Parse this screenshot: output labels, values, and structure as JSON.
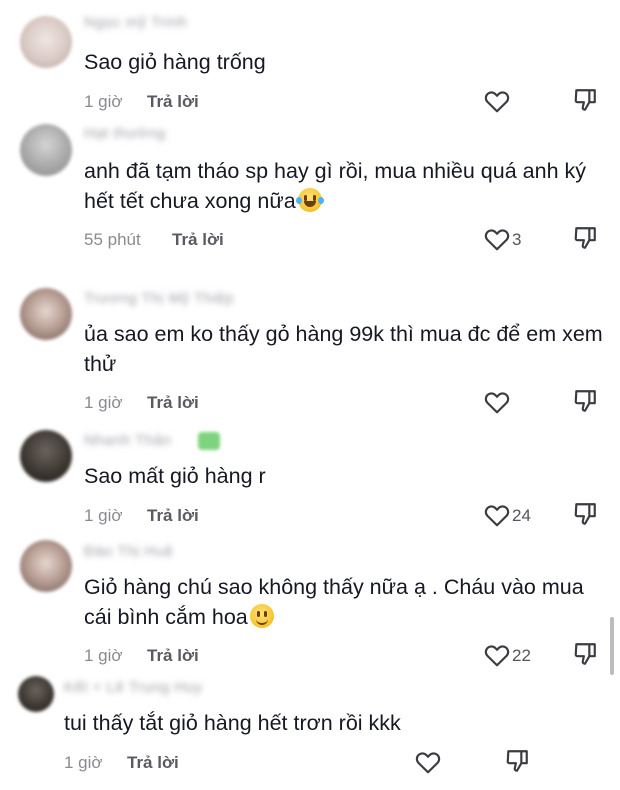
{
  "ui": {
    "reply_label": "Trả lời"
  },
  "comments": [
    {
      "username": "Ngọc mỹ Trinh",
      "text": "Sao giỏ hàng trống",
      "time": "1 giờ",
      "likes": ""
    },
    {
      "username": "Hạt thường",
      "text": "anh đã tạm tháo sp hay gì rồi, mua nhiều quá anh ký hết tết chưa xong nữa",
      "time": "55 phút",
      "likes": "3",
      "emoji": "face-with-tears-of-joy"
    },
    {
      "username": "Trương Thị Mỹ Thiệp",
      "text": "ủa sao em ko thấy gỏ hàng 99k thì mua đc để em xem thử",
      "time": "1 giờ",
      "likes": ""
    },
    {
      "username": "Nhanh Thân",
      "text": "Sao mất giỏ hàng r",
      "time": "1 giờ",
      "likes": "24"
    },
    {
      "username": "Đào Thị Huệ",
      "text": "Giỏ hàng chú sao không thấy nữa ạ . Cháu vào mua cái bình cắm hoa",
      "time": "1 giờ",
      "likes": "22",
      "emoji": "slightly-smiling-face"
    },
    {
      "username": "Kết + Lê Trung Huy",
      "text": "tui thấy tắt giỏ hàng hết trơn rồi kkk",
      "time": "1 giờ",
      "likes": ""
    }
  ]
}
